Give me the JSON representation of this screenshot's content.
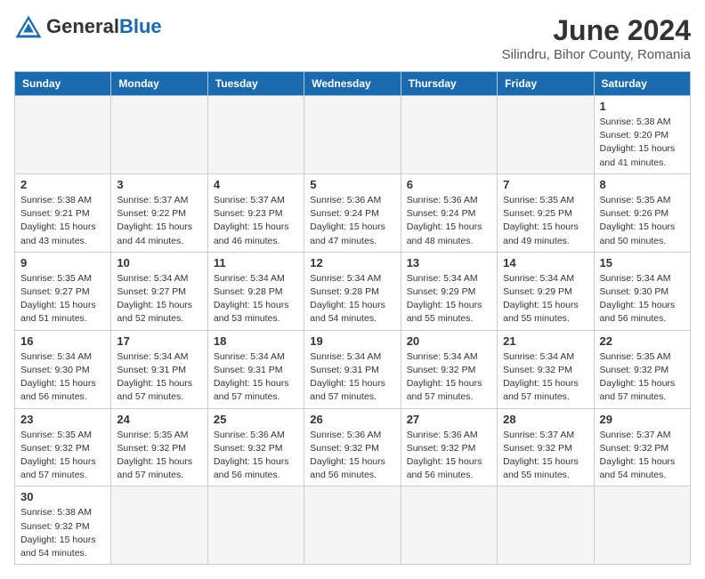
{
  "header": {
    "logo_general": "General",
    "logo_blue": "Blue",
    "month_year": "June 2024",
    "location": "Silindru, Bihor County, Romania"
  },
  "days_of_week": [
    "Sunday",
    "Monday",
    "Tuesday",
    "Wednesday",
    "Thursday",
    "Friday",
    "Saturday"
  ],
  "weeks": [
    [
      {
        "day": "",
        "info": ""
      },
      {
        "day": "",
        "info": ""
      },
      {
        "day": "",
        "info": ""
      },
      {
        "day": "",
        "info": ""
      },
      {
        "day": "",
        "info": ""
      },
      {
        "day": "",
        "info": ""
      },
      {
        "day": "1",
        "info": "Sunrise: 5:38 AM\nSunset: 9:20 PM\nDaylight: 15 hours\nand 41 minutes."
      }
    ],
    [
      {
        "day": "2",
        "info": "Sunrise: 5:38 AM\nSunset: 9:21 PM\nDaylight: 15 hours\nand 43 minutes."
      },
      {
        "day": "3",
        "info": "Sunrise: 5:37 AM\nSunset: 9:22 PM\nDaylight: 15 hours\nand 44 minutes."
      },
      {
        "day": "4",
        "info": "Sunrise: 5:37 AM\nSunset: 9:23 PM\nDaylight: 15 hours\nand 46 minutes."
      },
      {
        "day": "5",
        "info": "Sunrise: 5:36 AM\nSunset: 9:24 PM\nDaylight: 15 hours\nand 47 minutes."
      },
      {
        "day": "6",
        "info": "Sunrise: 5:36 AM\nSunset: 9:24 PM\nDaylight: 15 hours\nand 48 minutes."
      },
      {
        "day": "7",
        "info": "Sunrise: 5:35 AM\nSunset: 9:25 PM\nDaylight: 15 hours\nand 49 minutes."
      },
      {
        "day": "8",
        "info": "Sunrise: 5:35 AM\nSunset: 9:26 PM\nDaylight: 15 hours\nand 50 minutes."
      }
    ],
    [
      {
        "day": "9",
        "info": "Sunrise: 5:35 AM\nSunset: 9:27 PM\nDaylight: 15 hours\nand 51 minutes."
      },
      {
        "day": "10",
        "info": "Sunrise: 5:34 AM\nSunset: 9:27 PM\nDaylight: 15 hours\nand 52 minutes."
      },
      {
        "day": "11",
        "info": "Sunrise: 5:34 AM\nSunset: 9:28 PM\nDaylight: 15 hours\nand 53 minutes."
      },
      {
        "day": "12",
        "info": "Sunrise: 5:34 AM\nSunset: 9:28 PM\nDaylight: 15 hours\nand 54 minutes."
      },
      {
        "day": "13",
        "info": "Sunrise: 5:34 AM\nSunset: 9:29 PM\nDaylight: 15 hours\nand 55 minutes."
      },
      {
        "day": "14",
        "info": "Sunrise: 5:34 AM\nSunset: 9:29 PM\nDaylight: 15 hours\nand 55 minutes."
      },
      {
        "day": "15",
        "info": "Sunrise: 5:34 AM\nSunset: 9:30 PM\nDaylight: 15 hours\nand 56 minutes."
      }
    ],
    [
      {
        "day": "16",
        "info": "Sunrise: 5:34 AM\nSunset: 9:30 PM\nDaylight: 15 hours\nand 56 minutes."
      },
      {
        "day": "17",
        "info": "Sunrise: 5:34 AM\nSunset: 9:31 PM\nDaylight: 15 hours\nand 57 minutes."
      },
      {
        "day": "18",
        "info": "Sunrise: 5:34 AM\nSunset: 9:31 PM\nDaylight: 15 hours\nand 57 minutes."
      },
      {
        "day": "19",
        "info": "Sunrise: 5:34 AM\nSunset: 9:31 PM\nDaylight: 15 hours\nand 57 minutes."
      },
      {
        "day": "20",
        "info": "Sunrise: 5:34 AM\nSunset: 9:32 PM\nDaylight: 15 hours\nand 57 minutes."
      },
      {
        "day": "21",
        "info": "Sunrise: 5:34 AM\nSunset: 9:32 PM\nDaylight: 15 hours\nand 57 minutes."
      },
      {
        "day": "22",
        "info": "Sunrise: 5:35 AM\nSunset: 9:32 PM\nDaylight: 15 hours\nand 57 minutes."
      }
    ],
    [
      {
        "day": "23",
        "info": "Sunrise: 5:35 AM\nSunset: 9:32 PM\nDaylight: 15 hours\nand 57 minutes."
      },
      {
        "day": "24",
        "info": "Sunrise: 5:35 AM\nSunset: 9:32 PM\nDaylight: 15 hours\nand 57 minutes."
      },
      {
        "day": "25",
        "info": "Sunrise: 5:36 AM\nSunset: 9:32 PM\nDaylight: 15 hours\nand 56 minutes."
      },
      {
        "day": "26",
        "info": "Sunrise: 5:36 AM\nSunset: 9:32 PM\nDaylight: 15 hours\nand 56 minutes."
      },
      {
        "day": "27",
        "info": "Sunrise: 5:36 AM\nSunset: 9:32 PM\nDaylight: 15 hours\nand 56 minutes."
      },
      {
        "day": "28",
        "info": "Sunrise: 5:37 AM\nSunset: 9:32 PM\nDaylight: 15 hours\nand 55 minutes."
      },
      {
        "day": "29",
        "info": "Sunrise: 5:37 AM\nSunset: 9:32 PM\nDaylight: 15 hours\nand 54 minutes."
      }
    ],
    [
      {
        "day": "30",
        "info": "Sunrise: 5:38 AM\nSunset: 9:32 PM\nDaylight: 15 hours\nand 54 minutes."
      },
      {
        "day": "",
        "info": ""
      },
      {
        "day": "",
        "info": ""
      },
      {
        "day": "",
        "info": ""
      },
      {
        "day": "",
        "info": ""
      },
      {
        "day": "",
        "info": ""
      },
      {
        "day": "",
        "info": ""
      }
    ]
  ]
}
